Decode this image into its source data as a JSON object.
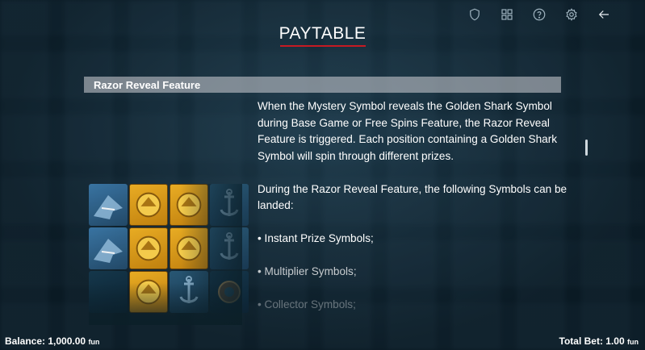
{
  "header": {
    "title": "PAYTABLE",
    "icons": [
      "shield-icon",
      "grid-icon",
      "help-icon",
      "gear-icon",
      "back-arrow-icon"
    ]
  },
  "section": {
    "title": "Razor Reveal Feature",
    "paragraph1": "When the Mystery Symbol reveals the Golden Shark Symbol during Base Game or Free Spins Feature, the Razor Reveal Feature is triggered. Each position containing a Golden Shark Symbol will spin through different prizes.",
    "paragraph2": "During the Razor Reveal Feature, the following Symbols can be landed:",
    "bullet1": "• Instant Prize Symbols;",
    "bullet2": "• Multiplier Symbols;",
    "bullet3": "• Collector Symbols;"
  },
  "footer": {
    "balance_label": "Balance:",
    "balance_value": "1,000.00",
    "balance_unit": "fun",
    "bet_label": "Total Bet:",
    "bet_value": "1.00",
    "bet_unit": "fun"
  },
  "colors": {
    "accent_underline": "#c61a22",
    "gold_symbol": "#f4b323"
  }
}
